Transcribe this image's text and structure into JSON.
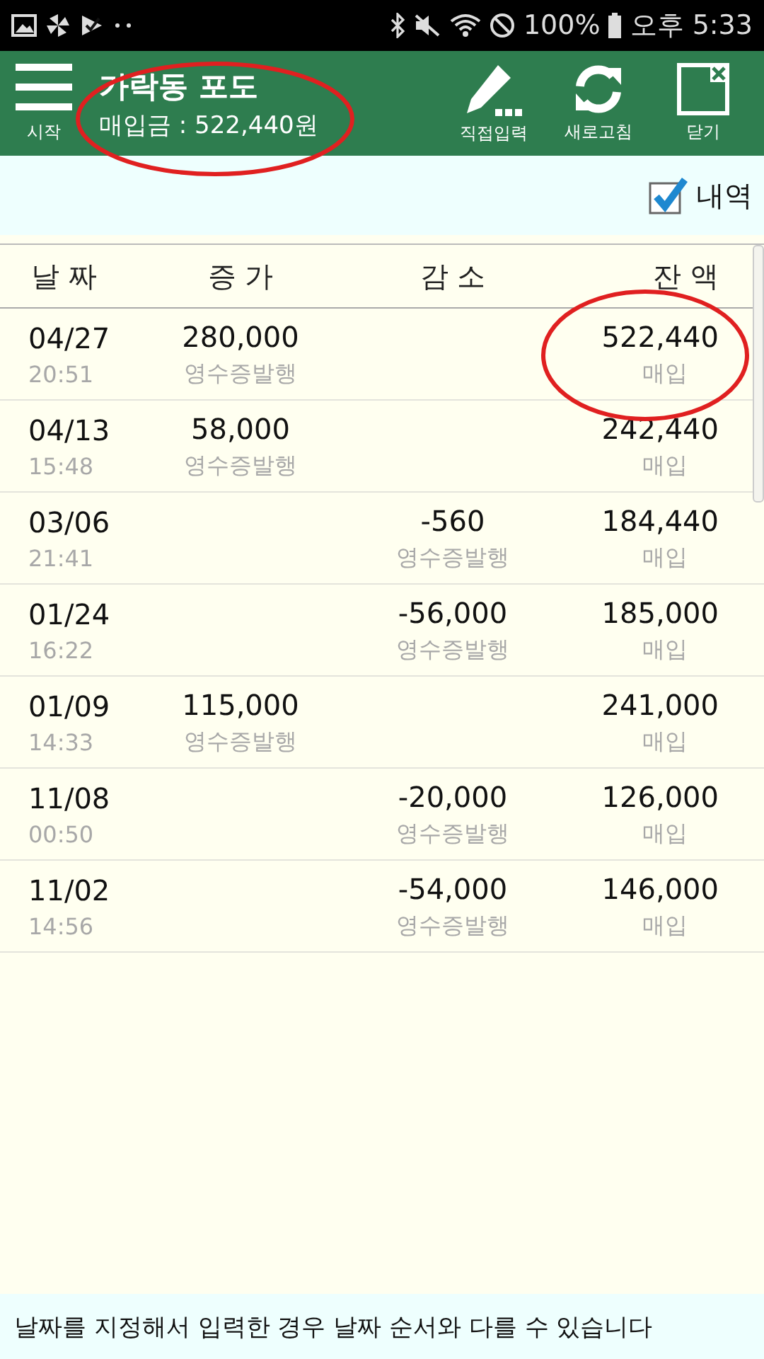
{
  "status_bar": {
    "battery": "100%",
    "time": "오후 5:33"
  },
  "header": {
    "menu_label": "시작",
    "title": "가락동 포도",
    "subtitle": "매입금 : 522,440원",
    "actions": [
      {
        "kind": "edit",
        "label": "직접입력"
      },
      {
        "kind": "refresh",
        "label": "새로고침"
      },
      {
        "kind": "close",
        "label": "닫기"
      }
    ]
  },
  "filter": {
    "label": "내역",
    "checked": true
  },
  "table": {
    "columns": [
      "날 짜",
      "증 가",
      "감 소",
      "잔 액"
    ],
    "rows": [
      {
        "date": "04/27",
        "time": "20:51",
        "increase": "280,000",
        "increase_note": "영수증발행",
        "balance": "522,440",
        "balance_note": "매입"
      },
      {
        "date": "04/13",
        "time": "15:48",
        "increase": "58,000",
        "increase_note": "영수증발행",
        "balance": "242,440",
        "balance_note": "매입"
      },
      {
        "date": "03/06",
        "time": "21:41",
        "decrease": "-560",
        "decrease_note": "영수증발행",
        "balance": "184,440",
        "balance_note": "매입"
      },
      {
        "date": "01/24",
        "time": "16:22",
        "decrease": "-56,000",
        "decrease_note": "영수증발행",
        "balance": "185,000",
        "balance_note": "매입"
      },
      {
        "date": "01/09",
        "time": "14:33",
        "increase": "115,000",
        "increase_note": "영수증발행",
        "balance": "241,000",
        "balance_note": "매입"
      },
      {
        "date": "11/08",
        "time": "00:50",
        "decrease": "-20,000",
        "decrease_note": "영수증발행",
        "balance": "126,000",
        "balance_note": "매입"
      },
      {
        "date": "11/02",
        "time": "14:56",
        "decrease": "-54,000",
        "decrease_note": "영수증발행",
        "balance": "146,000",
        "balance_note": "매입"
      }
    ]
  },
  "footer": {
    "note": "날짜를 지정해서 입력한 경우 날짜 순서와 다를 수 있습니다"
  }
}
